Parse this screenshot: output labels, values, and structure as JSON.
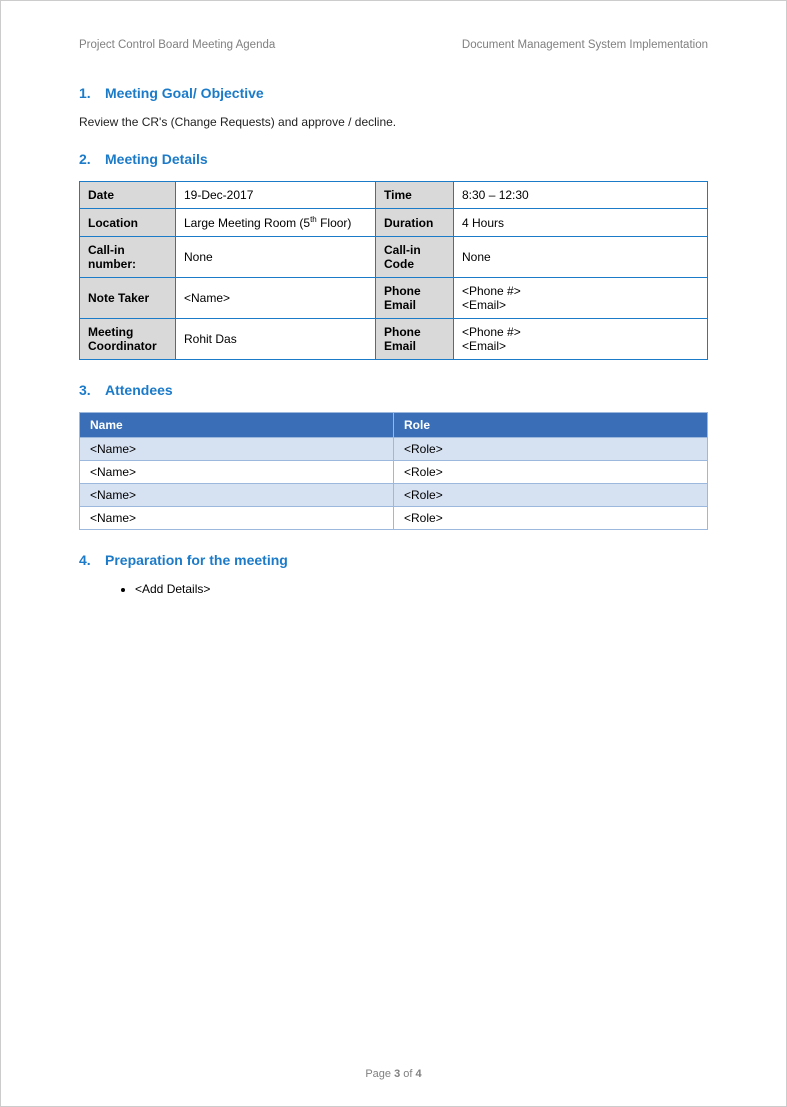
{
  "header": {
    "left": "Project Control Board Meeting Agenda",
    "right": "Document Management System Implementation"
  },
  "sections": {
    "s1": {
      "num": "1.",
      "title": "Meeting Goal/ Objective",
      "body": "Review the CR's (Change Requests) and approve / decline."
    },
    "s2": {
      "num": "2.",
      "title": "Meeting Details"
    },
    "s3": {
      "num": "3.",
      "title": "Attendees"
    },
    "s4": {
      "num": "4.",
      "title": "Preparation for the meeting",
      "bullet": "<Add Details>"
    }
  },
  "details": {
    "date_label": "Date",
    "date_value": "19-Dec-2017",
    "time_label": "Time",
    "time_value": "8:30 – 12:30",
    "location_label": "Location",
    "location_value_pre": "Large Meeting Room (5",
    "location_value_sup": "th",
    "location_value_post": " Floor)",
    "duration_label": "Duration",
    "duration_value": "4 Hours",
    "callin_label": "Call-in number:",
    "callin_value": "None",
    "callcode_label": "Call-in Code",
    "callcode_value": "None",
    "notetaker_label": "Note Taker",
    "notetaker_value": "<Name>",
    "phoneemail1_label": "Phone Email",
    "phoneemail1_value": "<Phone #>\n<Email>",
    "coordinator_label": "Meeting Coordinator",
    "coordinator_value": "Rohit Das",
    "phoneemail2_label": "Phone Email",
    "phoneemail2_value": "<Phone #>\n<Email>"
  },
  "attendees": {
    "header_name": "Name",
    "header_role": "Role",
    "rows": [
      {
        "name": "<Name>",
        "role": "<Role>"
      },
      {
        "name": "<Name>",
        "role": "<Role>"
      },
      {
        "name": "<Name>",
        "role": "<Role>"
      },
      {
        "name": "<Name>",
        "role": "<Role>"
      }
    ]
  },
  "footer": {
    "pre": "Page ",
    "cur": "3",
    "mid": " of ",
    "total": "4"
  }
}
